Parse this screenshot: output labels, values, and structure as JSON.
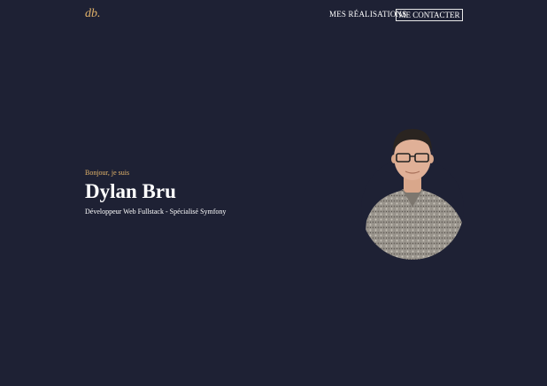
{
  "header": {
    "logo": "db.",
    "nav_realisations": "MES RÉALISATIONS",
    "nav_contact": "ME CONTACTER"
  },
  "hero": {
    "greeting": "Bonjour, je suis",
    "name": "Dylan Bru",
    "subtitle": "Développeur Web Fullstack - Spécialisé Symfony"
  },
  "colors": {
    "background": "#1e2134",
    "accent": "#e2b36a",
    "text": "#ffffff"
  }
}
